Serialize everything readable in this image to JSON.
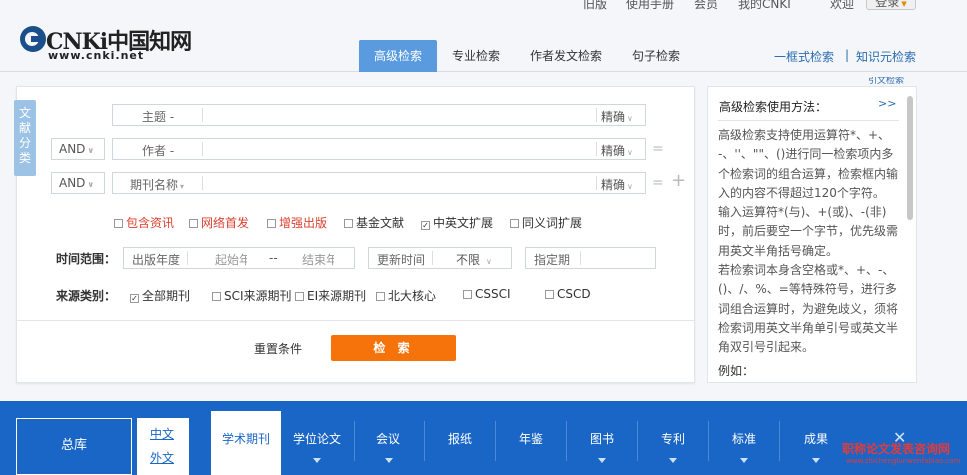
{
  "topbar": {
    "items": [
      "旧版",
      "使用手册",
      "会员",
      "我的CNKI",
      "欢迎"
    ],
    "login": "登录"
  },
  "logo": {
    "name": "CNKi中国知网",
    "url": "www.cnki.net"
  },
  "tabs": [
    "高级检索",
    "专业检索",
    "作者发文检索",
    "句子检索"
  ],
  "header_links": {
    "one_box": "一框式检索",
    "knowledge": "知识元检索",
    "sep": "|"
  },
  "side_tab": "文献分类",
  "fields": {
    "row1": {
      "label": "主题 -",
      "mode": "精确"
    },
    "row2": {
      "op": "AND",
      "label": "作者 -",
      "mode": "精确",
      "eq": "="
    },
    "row3": {
      "op": "AND",
      "label": "期刊名称",
      "mode": "精确",
      "eq": "=",
      "plus": "+"
    }
  },
  "options": [
    {
      "label": "包含资讯",
      "checked": false,
      "red": true
    },
    {
      "label": "网络首发",
      "checked": false,
      "red": true
    },
    {
      "label": "增强出版",
      "checked": false,
      "red": true
    },
    {
      "label": "基金文献",
      "checked": false,
      "red": false
    },
    {
      "label": "中英文扩展",
      "checked": true,
      "red": false
    },
    {
      "label": "同义词扩展",
      "checked": false,
      "red": false
    }
  ],
  "time": {
    "label": "时间范围：",
    "year_label": "出版年度",
    "start": "起始年",
    "dash": "--",
    "end": "结束年",
    "update_label": "更新时间",
    "update_value": "不限",
    "specify": "指定期"
  },
  "source": {
    "label": "来源类别：",
    "items": [
      {
        "label": "全部期刊",
        "checked": true
      },
      {
        "label": "SCI来源期刊",
        "checked": false
      },
      {
        "label": "EI来源期刊",
        "checked": false
      },
      {
        "label": "北大核心",
        "checked": false
      },
      {
        "label": "CSSCI",
        "checked": false
      },
      {
        "label": "CSCD",
        "checked": false
      }
    ]
  },
  "buttons": {
    "reset": "重置条件",
    "search": "检 索"
  },
  "help": {
    "title": "高级检索使用方法：",
    "more": ">>",
    "paragraphs": [
      "高级检索支持使用运算符*、+、-、''、\"\"、()进行同一检索项内多个检索词的组合运算，检索框内输入的内容不得超过120个字符。",
      "输入运算符*(与)、+(或)、-(非)时，前后要空一个字节，优先级需用英文半角括号确定。",
      "若检索词本身含空格或*、+、-、()、/、%、=等特殊符号，进行多词组合运算时，为避免歧义，须将检索词用英文半角单引号或英文半角双引号引起来。"
    ],
    "example": "例如："
  },
  "right_link": "引文检索",
  "bottom_nav": {
    "main": "总库",
    "lang_top": "中文",
    "lang_bottom": "外文",
    "items": [
      "学术期刊",
      "学位论文",
      "会议",
      "报纸",
      "年鉴",
      "图书",
      "专利",
      "标准",
      "成果"
    ],
    "active": "学术期刊"
  },
  "watermark": {
    "line1": "职称论文发表咨询网",
    "line2": "www.zhichenglunwenfabiao.com"
  }
}
